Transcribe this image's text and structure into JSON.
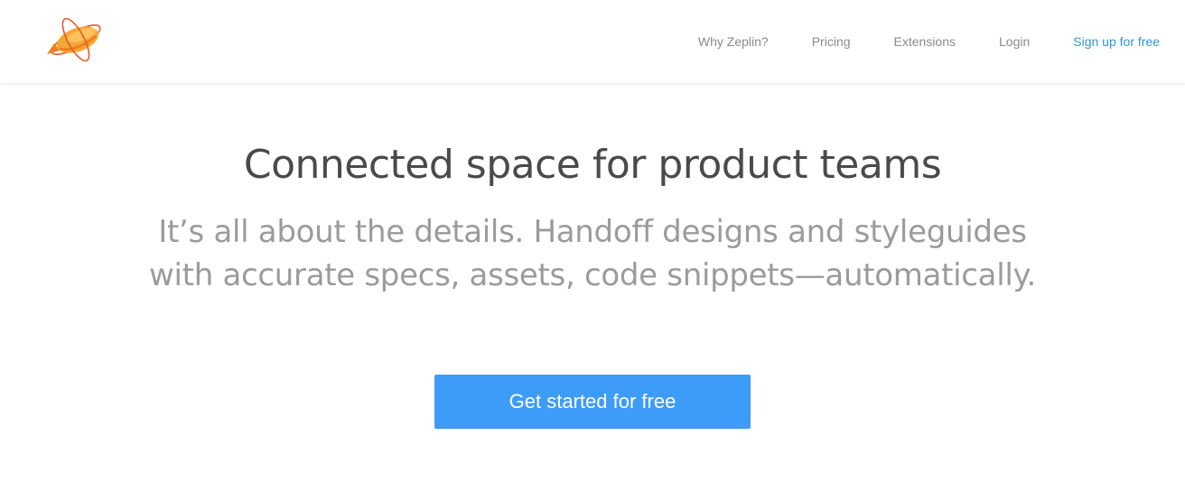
{
  "brand": {
    "logo_icon": "zeppelin-logo-icon",
    "colors": {
      "blimp_body": "#f7a736",
      "blimp_shadow": "#ef7f24",
      "orbit": "#e35a2b"
    }
  },
  "nav": {
    "items": [
      {
        "label": "Why Zeplin?"
      },
      {
        "label": "Pricing"
      },
      {
        "label": "Extensions"
      },
      {
        "label": "Login"
      }
    ],
    "signup_label": "Sign up for free"
  },
  "hero": {
    "title": "Connected space for product teams",
    "subtitle": "It’s all about the details. Handoff designs and styleguides with accurate specs, assets, code snippets—automatically.",
    "cta_label": "Get started for free"
  },
  "colors": {
    "accent": "#3d9cf7",
    "link_primary": "#2f95dc",
    "nav_text": "#8a8a8a",
    "title_text": "#4a4a4a",
    "subtitle_text": "#9b9b9b"
  }
}
